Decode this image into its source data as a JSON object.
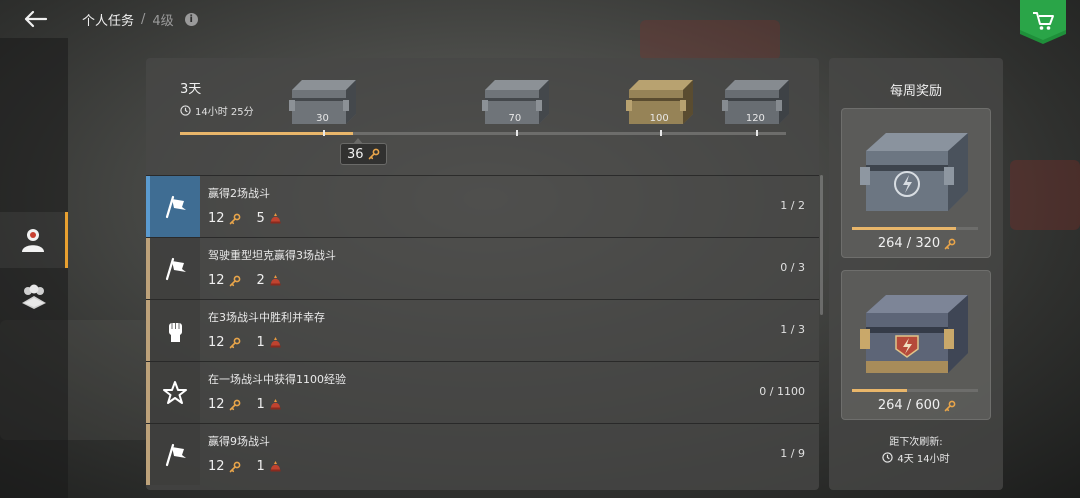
{
  "header": {
    "breadcrumb_main": "个人任务",
    "breadcrumb_sep": "/",
    "breadcrumb_level": "4级",
    "info_glyph": "i",
    "back_icon": "back-arrow-icon",
    "shop_icon": "cart-icon",
    "shop_color": "#1f8f3a"
  },
  "sidebar": {
    "items": [
      {
        "icon": "person-icon",
        "active": true
      },
      {
        "icon": "group-icon",
        "active": false
      }
    ]
  },
  "progress": {
    "period": "3天",
    "timer": "14小时 25分",
    "current": "36",
    "current_value": 36,
    "max_value": 126,
    "milestones": [
      {
        "label": "30",
        "value": 30,
        "crate": "steel-crate"
      },
      {
        "label": "70",
        "value": 70,
        "crate": "steel-crate"
      },
      {
        "label": "100",
        "value": 100,
        "crate": "camo-crate"
      },
      {
        "label": "120",
        "value": 120,
        "crate": "emblem-crate"
      }
    ]
  },
  "tasks": [
    {
      "title": "赢得2场战斗",
      "keys": "12",
      "tokens": "5",
      "progress": "1 / 2",
      "icon": "flag-icon",
      "highlight": true
    },
    {
      "title": "驾驶重型坦克赢得3场战斗",
      "keys": "12",
      "tokens": "2",
      "progress": "0 / 3",
      "icon": "flag-icon",
      "highlight": false
    },
    {
      "title": "在3场战斗中胜利并幸存",
      "keys": "12",
      "tokens": "1",
      "progress": "1 / 3",
      "icon": "fist-icon",
      "highlight": false
    },
    {
      "title": "在一场战斗中获得1100经验",
      "keys": "12",
      "tokens": "1",
      "progress": "0 / 1100",
      "icon": "star-icon",
      "highlight": false
    },
    {
      "title": "赢得9场战斗",
      "keys": "12",
      "tokens": "1",
      "progress": "1 / 9",
      "icon": "flag-icon",
      "highlight": false
    }
  ],
  "weekly": {
    "title": "每周奖励",
    "chests": [
      {
        "count": "264 / 320",
        "fraction": 0.825
      },
      {
        "count": "264 / 600",
        "fraction": 0.44
      }
    ],
    "refresh_label": "距下次刷新:",
    "refresh_time": "4天 14小时"
  },
  "colors": {
    "accent": "#e8a030",
    "progress_fill": "#e9b66a",
    "highlight_row": "#3f6d93"
  }
}
